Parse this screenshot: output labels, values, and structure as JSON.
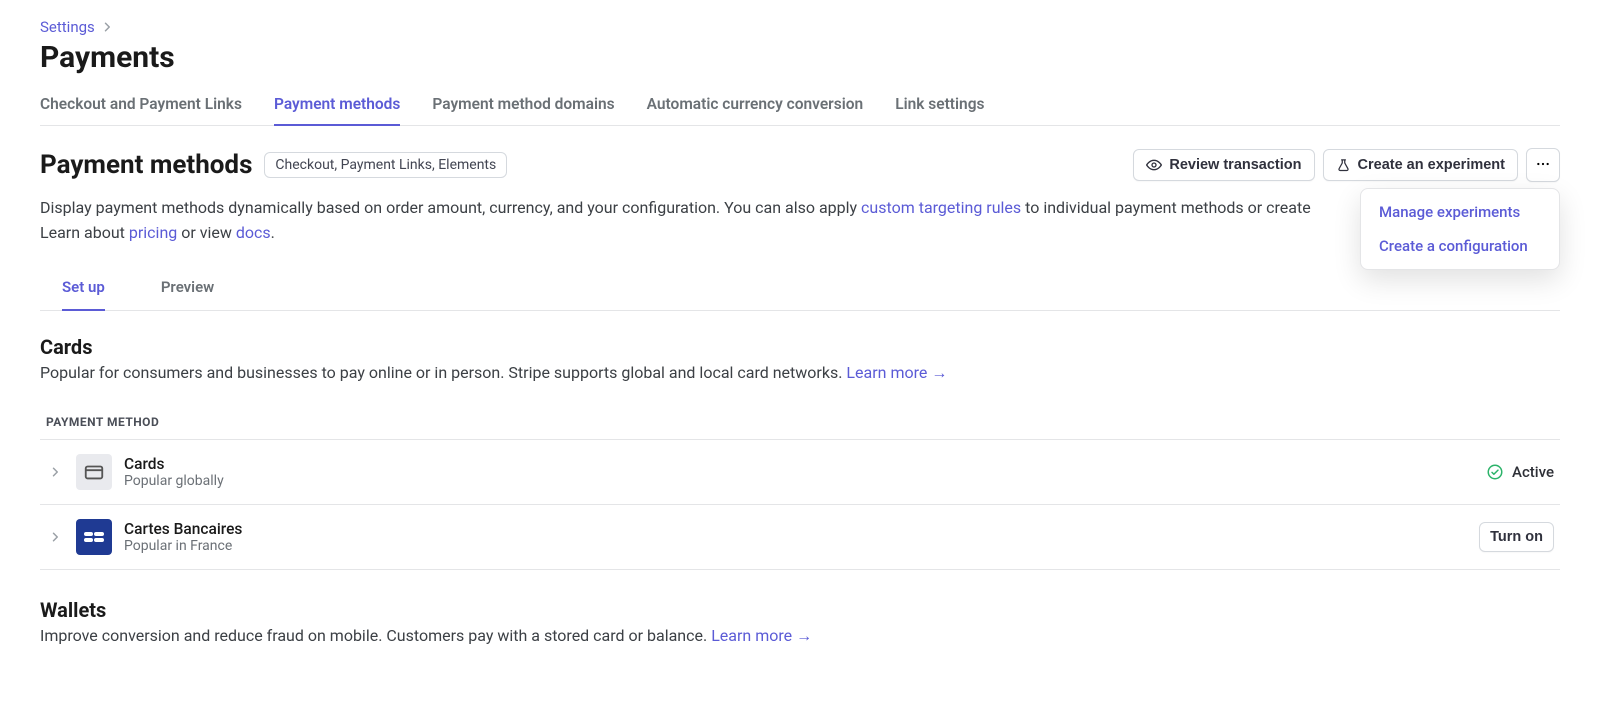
{
  "breadcrumb": {
    "parent": "Settings"
  },
  "title": "Payments",
  "tabs": [
    {
      "label": "Checkout and Payment Links"
    },
    {
      "label": "Payment methods"
    },
    {
      "label": "Payment method domains"
    },
    {
      "label": "Automatic currency conversion"
    },
    {
      "label": "Link settings"
    }
  ],
  "active_tab": "Payment methods",
  "section": {
    "title": "Payment methods",
    "badge": "Checkout, Payment Links, Elements"
  },
  "actions": {
    "review": "Review transaction",
    "experiment": "Create an experiment"
  },
  "dropdown": {
    "item1": "Manage experiments",
    "item2": "Create a configuration"
  },
  "description": {
    "part1": "Display payment methods dynamically based on order amount, currency, and your configuration. You can also apply ",
    "link1": "custom targeting rules",
    "part2": " to individual payment methods or create ",
    "part3": "Learn about ",
    "link2": "pricing",
    "part4": " or view ",
    "link3": "docs",
    "period": "."
  },
  "subtabs": [
    {
      "label": "Set up"
    },
    {
      "label": "Preview"
    }
  ],
  "active_subtab": "Set up",
  "cards_section": {
    "title": "Cards",
    "desc": "Popular for consumers and businesses to pay online or in person. Stripe supports global and local card networks. ",
    "learn_more": "Learn more"
  },
  "table": {
    "header": "PAYMENT METHOD",
    "rows": [
      {
        "name": "Cards",
        "sub": "Popular globally",
        "icon": "card",
        "status": "Active"
      },
      {
        "name": "Cartes Bancaires",
        "sub": "Popular in France",
        "icon": "cb",
        "action": "Turn on"
      }
    ]
  },
  "wallets_section": {
    "title": "Wallets",
    "desc": "Improve conversion and reduce fraud on mobile. Customers pay with a stored card or balance. ",
    "learn_more": "Learn more"
  }
}
